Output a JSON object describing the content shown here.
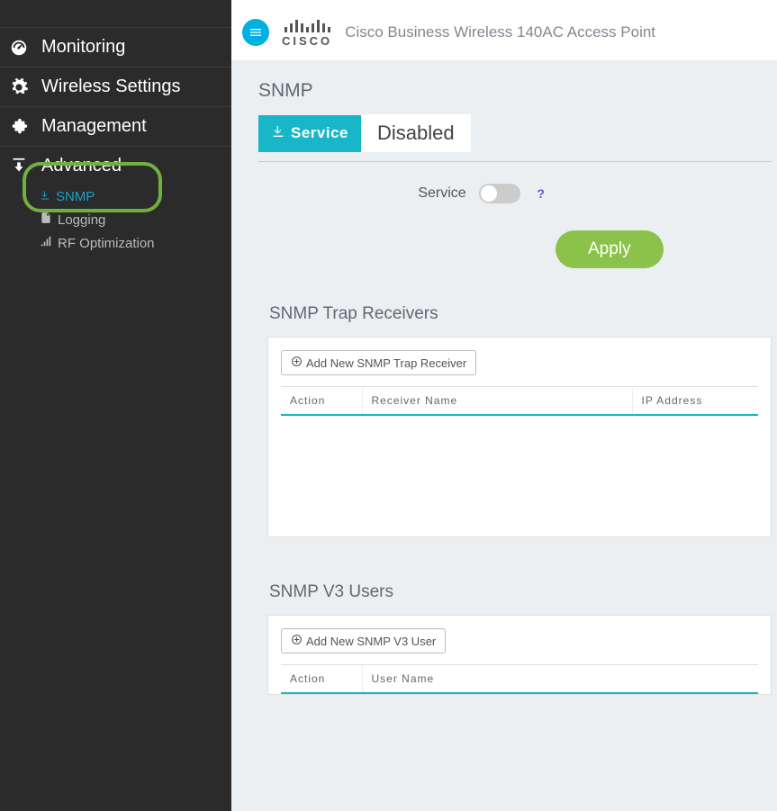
{
  "header": {
    "product_name": "Cisco Business Wireless 140AC Access Point",
    "logo_text": "CISCO"
  },
  "sidebar": {
    "items": [
      {
        "label": "Monitoring",
        "icon": "gauge"
      },
      {
        "label": "Wireless Settings",
        "icon": "gear"
      },
      {
        "label": "Management",
        "icon": "puzzle"
      },
      {
        "label": "Advanced",
        "icon": "download"
      }
    ],
    "advanced_sub": [
      {
        "label": "SNMP",
        "icon": "download-arrow",
        "active": true
      },
      {
        "label": "Logging",
        "icon": "file"
      },
      {
        "label": "RF Optimization",
        "icon": "signal"
      }
    ]
  },
  "snmp": {
    "title": "SNMP",
    "service_tab": "Service",
    "service_status": "Disabled",
    "toggle_label": "Service",
    "apply_label": "Apply"
  },
  "trap_section": {
    "title": "SNMP Trap Receivers",
    "add_label": "Add New SNMP Trap Receiver",
    "columns": [
      "Action",
      "Receiver Name",
      "IP Address"
    ]
  },
  "v3_section": {
    "title": "SNMP V3 Users",
    "add_label": "Add New SNMP V3 User",
    "columns": [
      "Action",
      "User Name"
    ]
  }
}
